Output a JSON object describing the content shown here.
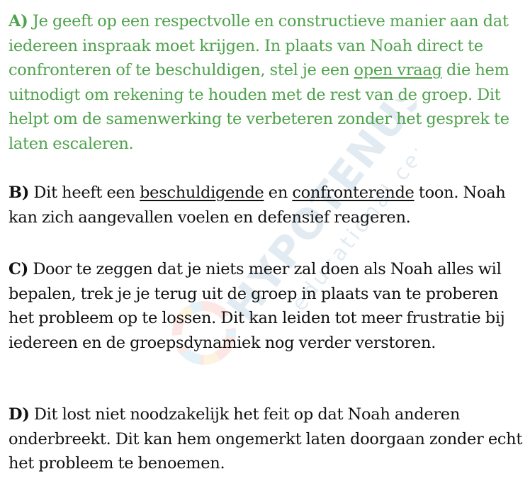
{
  "paragraphs": {
    "a": {
      "letter": "A)",
      "text1": " Je geeft op een respectvolle en constructieve manier aan dat iedereen inspraak moet krijgen. In plaats van Noah direct te confronteren of te beschuldigen, stel je een ",
      "u1": "open vraag",
      "text2": " die hem uitnodigt om rekening te houden met de rest van de groep. Dit helpt om de samenwerking te verbeteren zonder het gesprek te laten escaleren."
    },
    "b": {
      "letter": "B)",
      "text1": " Dit heeft een ",
      "u1": "beschuldigende",
      "text2": " en ",
      "u2": "confronterende",
      "text3": " toon. Noah kan zich aangevallen voelen en defensief reageren."
    },
    "c": {
      "letter": "C)",
      "text1": " Door te zeggen dat je niets meer zal doen als Noah alles wil bepalen, trek je je terug uit de groep in plaats van te proberen het probleem op te lossen. Dit kan leiden tot meer frustratie bij iedereen en de groepsdynamiek nog verder verstoren."
    },
    "d": {
      "letter": "D)",
      "text1": " Dit lost niet noodzakelijk het feit op dat Noah anderen onderbreekt. Dit kan hem ongemerkt laten doorgaan zonder echt het probleem te benoemen."
    }
  },
  "watermark": {
    "brand": "HYPOTENUSE",
    "sub": "educational center"
  },
  "colors": {
    "correct_answer": "#4ea24b",
    "text": "#111111"
  }
}
